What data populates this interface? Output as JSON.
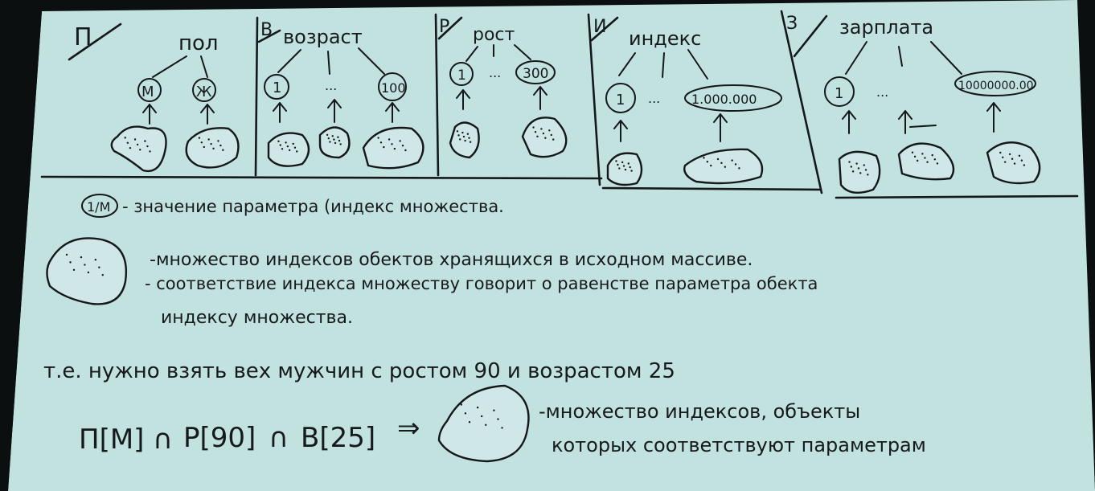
{
  "colors": {
    "paper": "#c2e2e0",
    "ink": "#14181d",
    "background": "#0c0f10"
  },
  "sections": [
    {
      "letter": "П",
      "title": "пол",
      "values": [
        "М",
        "Ж"
      ]
    },
    {
      "letter": "В",
      "title": "возраст",
      "values": [
        "1",
        "...",
        "100"
      ]
    },
    {
      "letter": "Р",
      "title": "рост",
      "values": [
        "1",
        "...",
        "300"
      ]
    },
    {
      "letter": "И",
      "title": "индекс",
      "values": [
        "1",
        "...",
        "1.000.000"
      ]
    },
    {
      "letter": "З",
      "title": "зарплата",
      "values": [
        "1",
        "...",
        "10000000.00"
      ]
    }
  ],
  "legend": {
    "marker": "1/M",
    "marker_text": "- значение параметра (индекс множества.",
    "set_line1": "-множество индексов обектов хранящихся в исходном массиве.",
    "set_line2": "- соответствие индекса множеству говорит о равенстве параметра обекта",
    "set_line3": "индексу множества."
  },
  "example": "т.е. нужно взять вех мужчин с ростом 90 и возрастом 25",
  "formula": {
    "part1": "П[М]",
    "op1": "∩",
    "part2": "Р[90]",
    "op2": "∩",
    "part3": "В[25]",
    "arrow": "⇒"
  },
  "result": {
    "line1": "-множество индексов, объекты",
    "line2": "которых соответствуют параметрам"
  }
}
